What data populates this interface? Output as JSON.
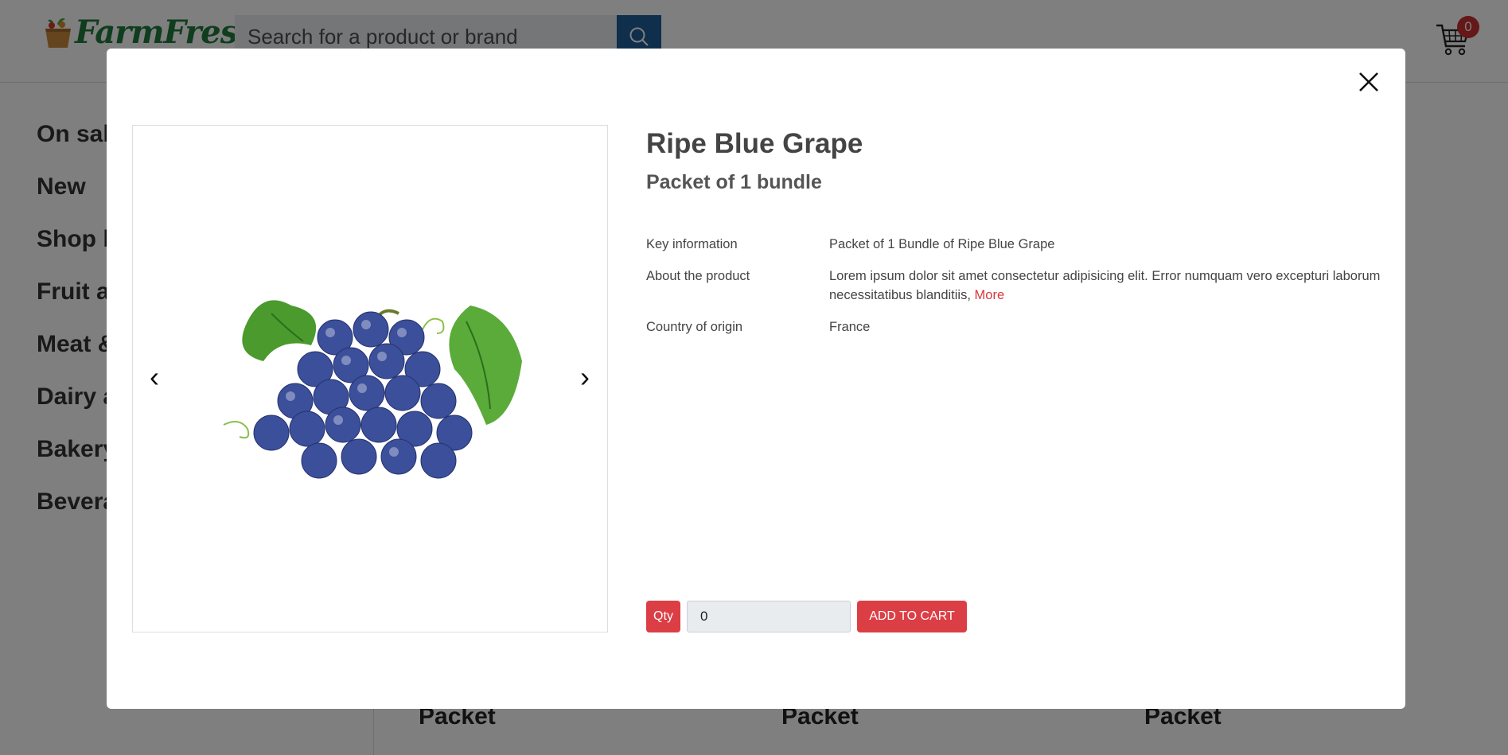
{
  "header": {
    "logo_text": "FarmFresh",
    "search_placeholder": "Search for a product or brand",
    "cart_count": "0"
  },
  "sidebar": {
    "items": [
      "On sale",
      "New",
      "Shop by",
      "Fruit and",
      "Meat &",
      "Dairy and",
      "Bakery",
      "Beverages"
    ]
  },
  "cards": {
    "titles": [
      "Packet",
      "Packet",
      "Packet"
    ]
  },
  "modal": {
    "title": "Ripe Blue Grape",
    "subtitle": "Packet of 1 bundle",
    "prev_icon": "‹",
    "next_icon": "›",
    "rows": [
      {
        "label": "Key information",
        "value": "Packet of 1 Bundle of Ripe Blue Grape"
      },
      {
        "label": "About the product",
        "value": "Lorem ipsum dolor sit amet consectetur adipisicing elit. Error numquam vero excepturi laborum necessitatibus blanditiis,",
        "link": "More"
      },
      {
        "label": "Country of origin",
        "value": "France"
      }
    ],
    "qty_label": "Qty",
    "qty_value": "0",
    "add_to_cart": "ADD TO CART"
  },
  "colors": {
    "accent": "#dc3e45",
    "search_button": "#1f5f9a",
    "brand_green": "#1f7a3a"
  },
  "icons": {
    "search": "search-icon",
    "cart": "cart-icon",
    "close": "close-icon"
  }
}
